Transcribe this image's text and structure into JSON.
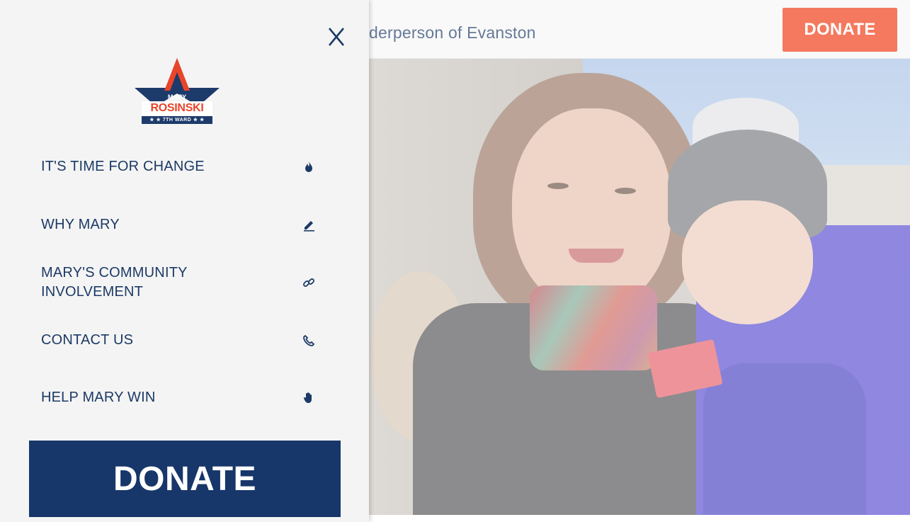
{
  "header": {
    "tagline": "derperson of Evanston",
    "donate_label": "DONATE"
  },
  "menu": {
    "close_icon": "close-icon",
    "logo": {
      "top_text": "MARY",
      "name": "ROSINSKI",
      "ward": "★ ★ 7TH WARD ★ ★"
    },
    "items": [
      {
        "label": "IT'S TIME FOR CHANGE",
        "icon": "fire-icon"
      },
      {
        "label": "WHY MARY",
        "icon": "pencil-icon"
      },
      {
        "label": "MARY'S COMMUNITY INVOLVEMENT",
        "icon": "link-icon"
      },
      {
        "label": "CONTACT US",
        "icon": "phone-icon"
      },
      {
        "label": "HELP MARY WIN",
        "icon": "hand-icon"
      }
    ],
    "donate_label": "DONATE"
  },
  "colors": {
    "navy": "#17366a",
    "accent_orange": "#f03a12",
    "menu_bg": "#f4f4f4",
    "logo_red": "#e8452a"
  }
}
